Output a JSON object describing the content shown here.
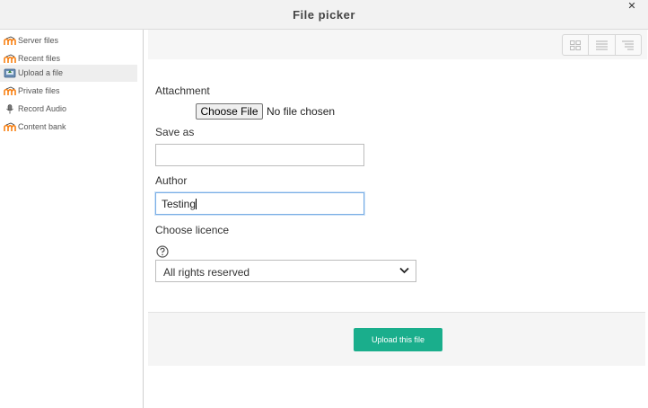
{
  "window": {
    "title": "File picker",
    "close_symbol": "✕"
  },
  "sidebar": {
    "items": [
      {
        "label": "Server files",
        "icon": "moodle-icon",
        "active": false
      },
      {
        "label": "Recent files",
        "icon": "moodle-icon",
        "active": false
      },
      {
        "label": "Upload a file",
        "icon": "upload-icon",
        "active": true
      },
      {
        "label": "Private files",
        "icon": "moodle-icon",
        "active": false
      },
      {
        "label": "Record Audio",
        "icon": "microphone-icon",
        "active": false
      },
      {
        "label": "Content bank",
        "icon": "moodle-icon",
        "active": false
      }
    ]
  },
  "toolbar": {
    "views": [
      "grid-view-icon",
      "list-view-icon",
      "tree-view-icon"
    ]
  },
  "form": {
    "attachment_label": "Attachment",
    "choose_file_label": "Choose File",
    "no_file_text": "No file chosen",
    "save_as_label": "Save as",
    "save_as_value": "",
    "author_label": "Author",
    "author_value": "Testing",
    "licence_label": "Choose licence",
    "licence_selected": "All rights reserved"
  },
  "footer": {
    "upload_label": "Upload this file"
  },
  "colors": {
    "accent": "#1aae8c",
    "moodle_orange": "#f98012",
    "focus_border": "#7aaee5"
  }
}
